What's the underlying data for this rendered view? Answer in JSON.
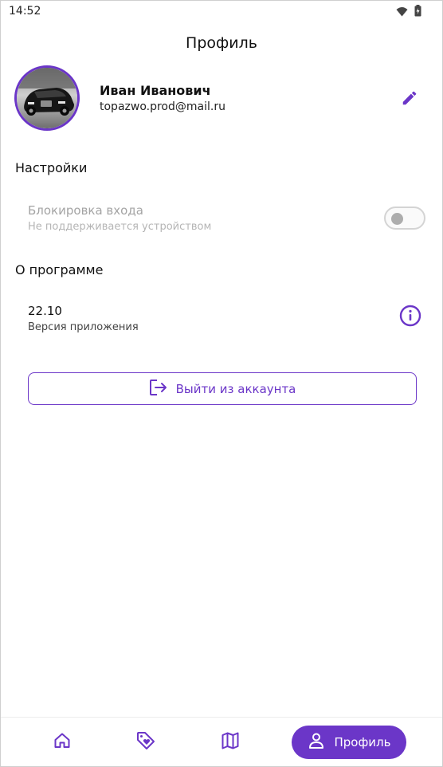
{
  "status_bar": {
    "time": "14:52",
    "icons": [
      "wifi-icon",
      "battery-icon"
    ]
  },
  "header": {
    "title": "Профиль"
  },
  "profile": {
    "name": "Иван Иванович",
    "email": "topazwo.prod@mail.ru",
    "avatar": "car-photo-avatar",
    "edit_icon": "pencil-icon"
  },
  "settings": {
    "title": "Настройки",
    "login_lock": {
      "label": "Блокировка входа",
      "sublabel": "Не поддерживается устройством",
      "enabled": false,
      "disabled": true
    }
  },
  "about": {
    "title": "О программе",
    "version": "22.10",
    "version_label": "Версия приложения",
    "info_icon": "info-icon"
  },
  "logout": {
    "label": "Выйти из аккаунта",
    "icon": "logout-icon"
  },
  "bottom_nav": {
    "items": [
      {
        "name": "home",
        "icon": "home-icon",
        "active": false
      },
      {
        "name": "offers",
        "icon": "tag-heart-icon",
        "active": false
      },
      {
        "name": "map",
        "icon": "map-icon",
        "active": false
      },
      {
        "name": "profile",
        "icon": "person-icon",
        "label": "Профиль",
        "active": true
      }
    ]
  },
  "colors": {
    "accent": "#6b36c8",
    "disabled_text": "#a4a4a4",
    "toggle_knob": "#adadad"
  }
}
